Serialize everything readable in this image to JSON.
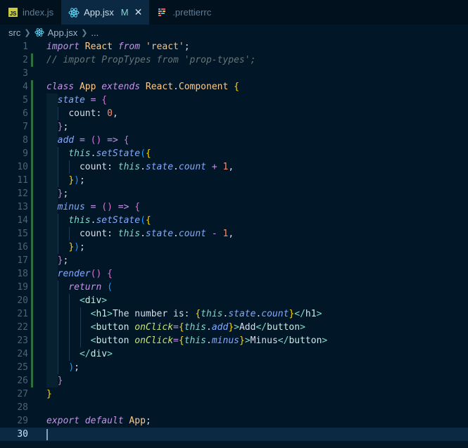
{
  "tabs": [
    {
      "label": "index.js",
      "icon": "js-file-icon",
      "active": false
    },
    {
      "label": "App.jsx",
      "icon": "react-icon",
      "active": true,
      "modified": "M",
      "close": "✕"
    },
    {
      "label": ".prettierrc",
      "icon": "prettier-icon",
      "active": false
    }
  ],
  "breadcrumb": {
    "folder": "src",
    "file": "App.jsx",
    "more": "..."
  },
  "line_numbers": [
    "1",
    "2",
    "3",
    "4",
    "5",
    "6",
    "7",
    "8",
    "9",
    "10",
    "11",
    "12",
    "13",
    "14",
    "15",
    "16",
    "17",
    "18",
    "19",
    "20",
    "21",
    "22",
    "23",
    "24",
    "25",
    "26",
    "27",
    "28",
    "29",
    "30"
  ],
  "current_line": "30",
  "code_lines": [
    "import React from 'react';",
    "// import PropTypes from 'prop-types';",
    "",
    "class App extends React.Component {",
    "  state = {",
    "    count: 0,",
    "  };",
    "  add = () => {",
    "    this.setState({",
    "      count: this.state.count + 1,",
    "    });",
    "  };",
    "  minus = () => {",
    "    this.setState({",
    "      count: this.state.count - 1,",
    "    });",
    "  };",
    "  render() {",
    "    return (",
    "      <div>",
    "        <h1>The number is: {this.state.count}</h1>",
    "        <button onClick={this.add}>Add</button>",
    "        <button onClick={this.minus}>Minus</button>",
    "      </div>",
    "    );",
    "  }",
    "}",
    "",
    "export default App;",
    ""
  ],
  "colors": {
    "background": "#011627",
    "keyword": "#c792ea",
    "string": "#ecc48d",
    "property": "#7fdbca",
    "function": "#82aaff",
    "number": "#f78c6c",
    "comment": "#637777",
    "modified_gutter": "#2e6f40"
  }
}
